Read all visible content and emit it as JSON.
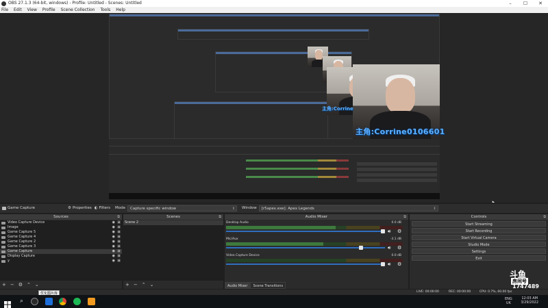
{
  "window": {
    "title": "OBS 27.1.3 (64-bit, windows) - Profile: Untitled - Scenes: Untitled",
    "controls": [
      "–",
      "☐",
      "✕"
    ]
  },
  "menu": [
    "File",
    "Edit",
    "View",
    "Profile",
    "Scene Collection",
    "Tools",
    "Help"
  ],
  "preview": {
    "overlay_text": "主角:Corrine0106601",
    "overlay_text_small": "主角:Corrine"
  },
  "source_toolbar": {
    "selected_source": "Game Capture",
    "properties_label": "Properties",
    "filters_label": "Filters",
    "mode_label": "Mode",
    "mode_value": "Capture specific window",
    "window_label": "Window",
    "window_value": "[r5apex.exe]: Apex Legends"
  },
  "sources": {
    "title": "Sources",
    "items": [
      {
        "label": "Video Capture Device",
        "selected": false
      },
      {
        "label": "Image",
        "selected": false
      },
      {
        "label": "Game Capture 5",
        "selected": false
      },
      {
        "label": "Game Capture 4",
        "selected": false
      },
      {
        "label": "Game Capture 2",
        "selected": false
      },
      {
        "label": "Game Capture 3",
        "selected": false
      },
      {
        "label": "Game Capture",
        "selected": true
      },
      {
        "label": "Display Capture",
        "selected": false
      },
      {
        "label": "y",
        "selected": false
      }
    ]
  },
  "scenes": {
    "title": "Scenes",
    "items": [
      {
        "label": "Scene 2",
        "selected": true
      }
    ]
  },
  "mixer": {
    "title": "Audio Mixer",
    "channels": [
      {
        "name": "Desktop Audio",
        "db": "0.0 dB",
        "meter_level": 0.62,
        "fader": 1.0
      },
      {
        "name": "Mic/Aux",
        "db": "-3.1 dB",
        "meter_level": 0.55,
        "fader": 0.86
      },
      {
        "name": "Video Capture Device",
        "db": "0.0 dB",
        "meter_level": 0.0,
        "fader": 1.0
      }
    ],
    "tabs": [
      "Audio Mixer",
      "Scene Transitions"
    ]
  },
  "controls": {
    "title": "Controls",
    "buttons": [
      "Start Streaming",
      "Start Recording",
      "Start Virtual Camera",
      "Studio Mode",
      "Settings",
      "Exit"
    ]
  },
  "status": {
    "live": "LIVE: 00:00:00",
    "rec": "REC: 00:00:00",
    "cpu": "CPU: 0.7%, 60.00 fps"
  },
  "douyu": {
    "brand": "斗鱼",
    "brand2": "房间号",
    "room": "1747489"
  },
  "taskbar": {
    "tooltip": "优化图片库",
    "lang": "ENG",
    "region": "UK",
    "time": "12:03 AM",
    "date": "3/29/2022"
  },
  "icons": {
    "search": "search-icon",
    "obs": "obs-icon",
    "chrome": "chrome-icon",
    "spotify": "spotify-icon"
  },
  "colors": {
    "panel": "#2b2b2b",
    "accent": "#2f6fc0",
    "overlay_text": "#5fb0ff"
  }
}
